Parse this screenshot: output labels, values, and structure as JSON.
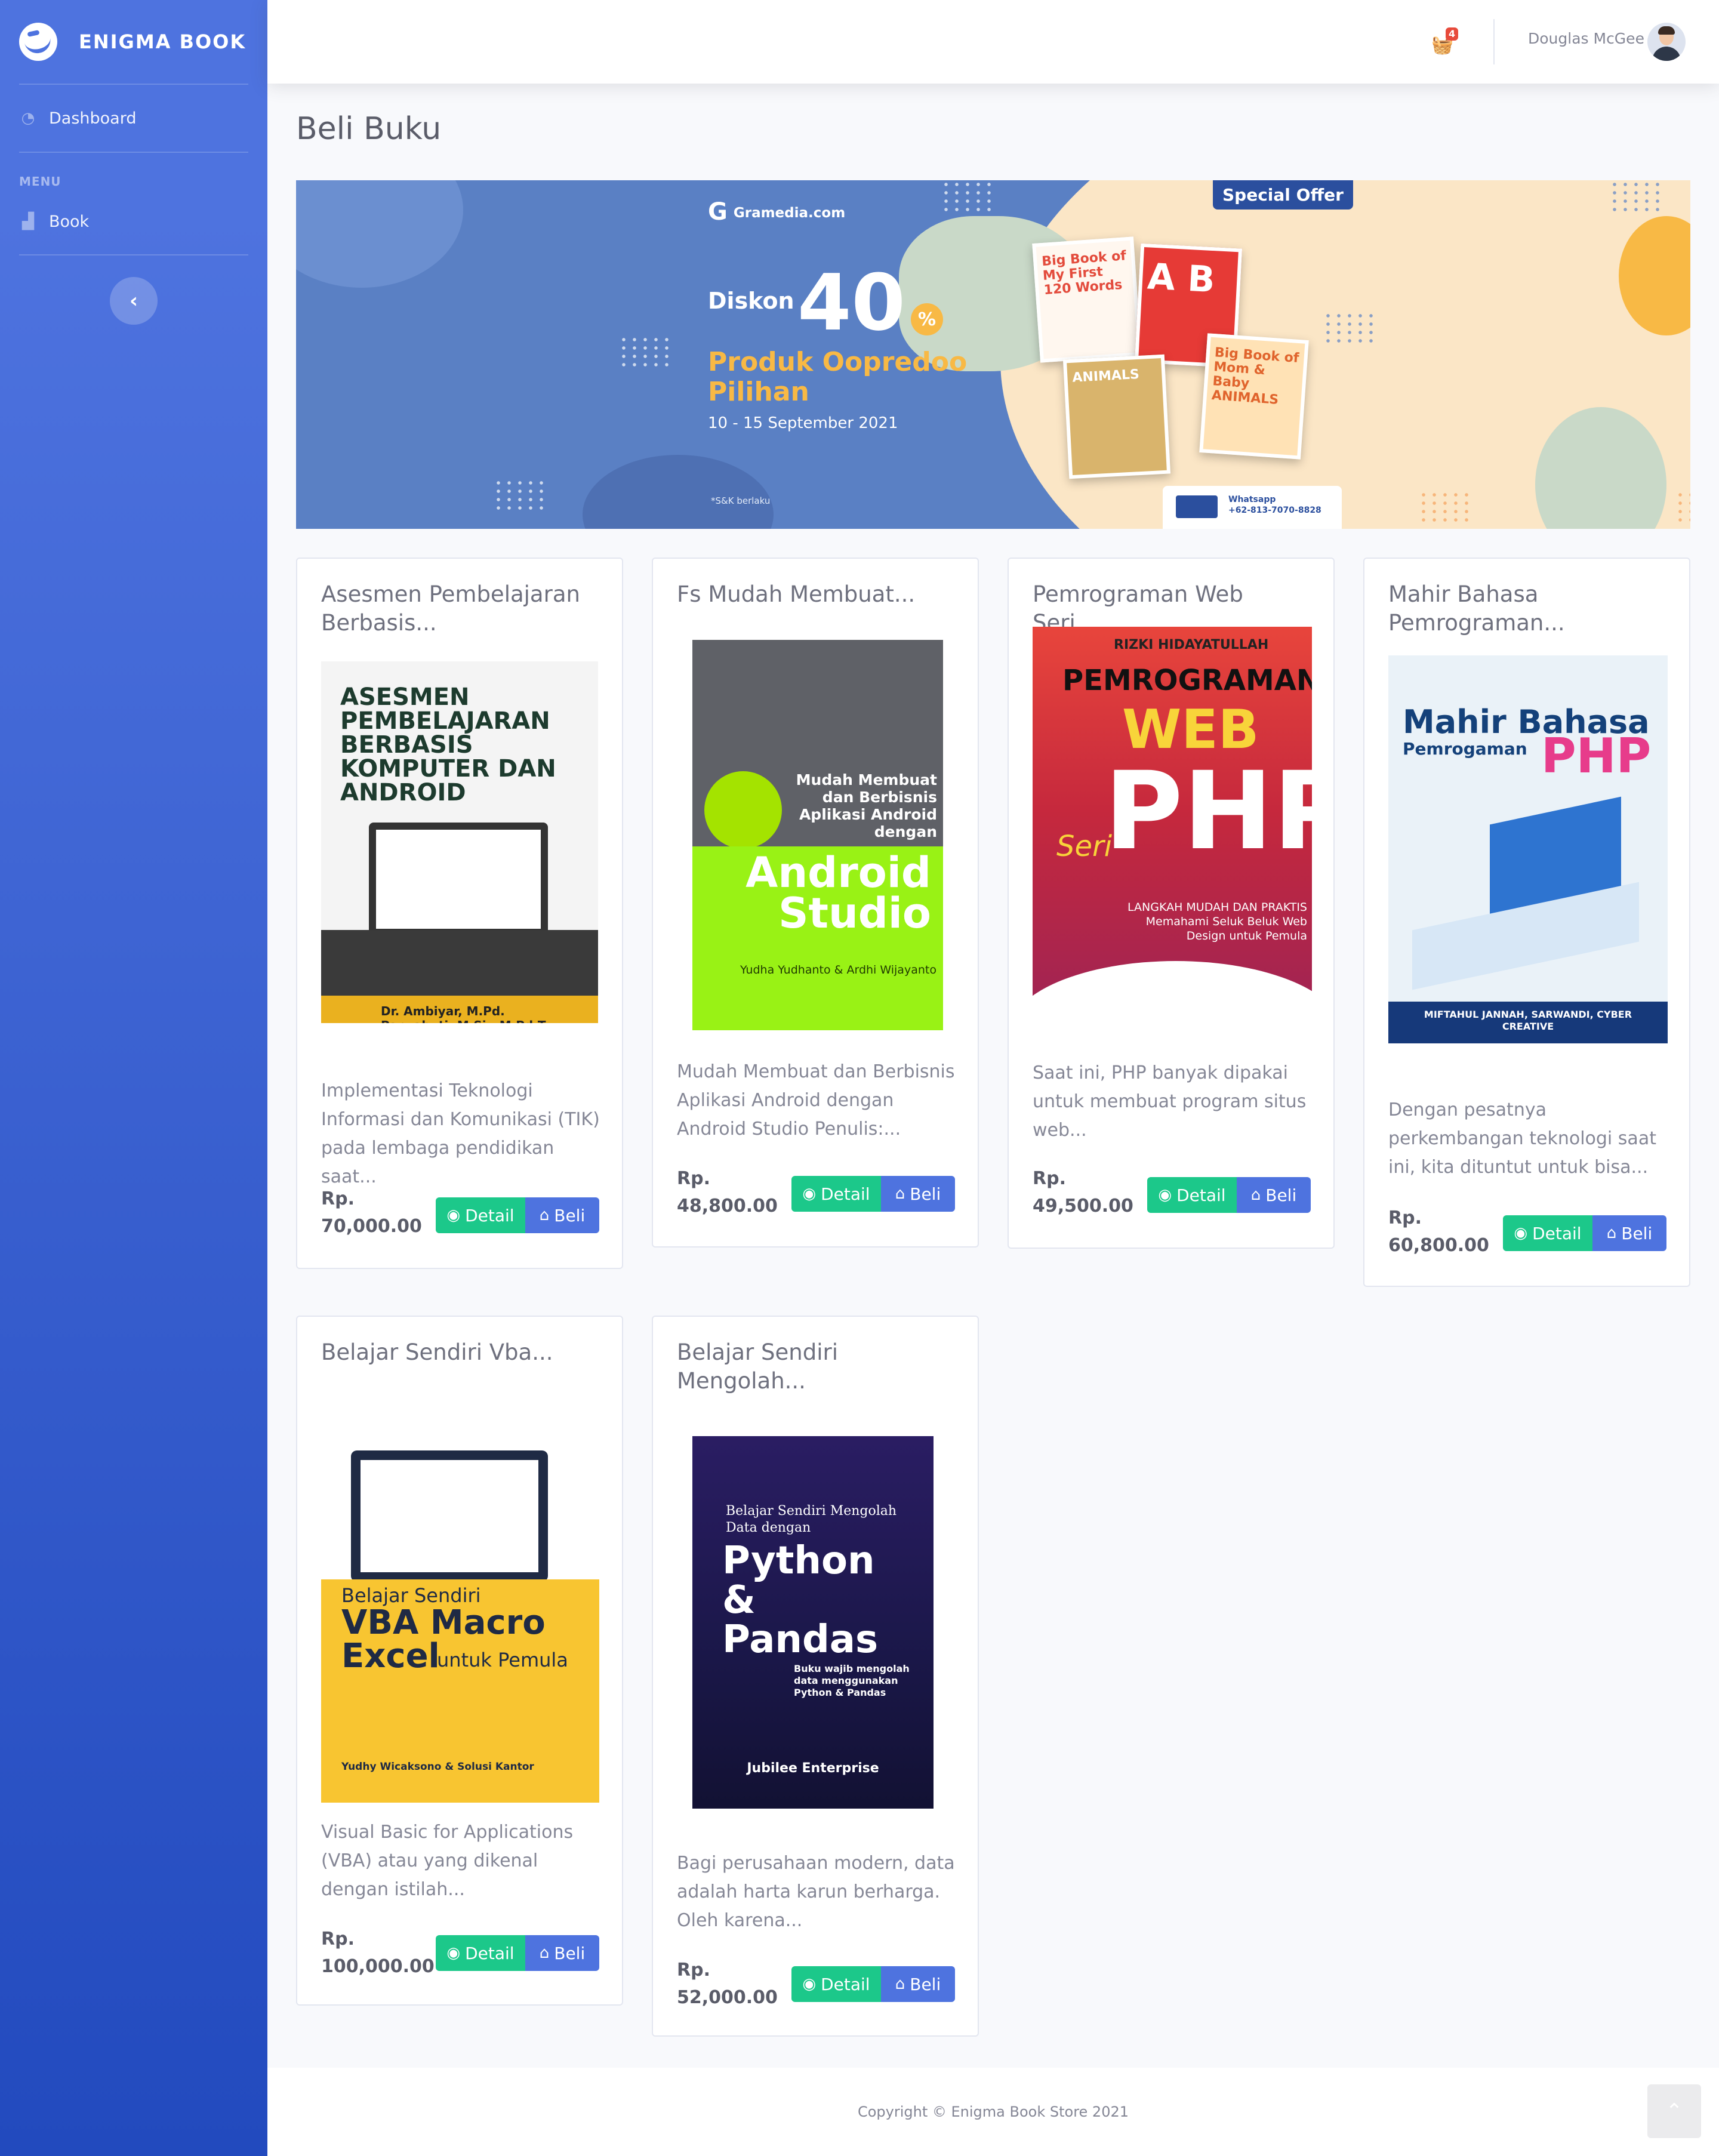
{
  "brand": {
    "name": "ENIGMA BOOK"
  },
  "sidebar": {
    "items": [
      {
        "label": "Dashboard",
        "icon": "tachometer-icon"
      },
      {
        "label": "Book",
        "icon": "chart-area-icon"
      }
    ],
    "heading": "MENU",
    "toggle_icon": "chevron-left-icon"
  },
  "topbar": {
    "cart_count": "4",
    "user_name": "Douglas McGee"
  },
  "page": {
    "title": "Beli Buku"
  },
  "banner": {
    "store": "Gramedia.com",
    "offer": "Special Offer",
    "discount_word": "Diskon",
    "discount_number": "40",
    "discount_symbol": "%",
    "product": "Produk Oopredoo Pilihan",
    "dates": "10 - 15 September 2021",
    "terms": "*S&K berlaku",
    "whatsapp_label": "Whatsapp",
    "whatsapp_number": "+62-813-7070-8828",
    "book1": "Big Book of My First 120 Words",
    "book2": "A B",
    "book3": "ANIMALS",
    "book4": "Big Book of Mom & Baby ANIMALS"
  },
  "buttons": {
    "detail": "Detail",
    "beli": "Beli"
  },
  "books": [
    {
      "title": "Asesmen Pembelajaran Berbasis...",
      "cover_title": "ASESMEN PEMBELAJARAN BERBASIS KOMPUTER DAN ANDROID",
      "cover_authors": "Dr. Ambiyar, M.Pd. Panyahuti, M.Si., M.Pd.T.",
      "description": "Implementasi Teknologi Informasi dan Komunikasi (TIK) pada lembaga pendidikan saat...",
      "price_label": "Rp.",
      "price": "70,000.00"
    },
    {
      "title": "Fs Mudah Membuat...",
      "cover_title": "Mudah Membuat dan Berbisnis Aplikasi Android dengan",
      "cover_brand": "Android Studio",
      "cover_authors": "Yudha Yudhanto & Ardhi Wijayanto",
      "description": "Mudah Membuat dan Berbisnis Aplikasi Android dengan Android Studio Penulis:...",
      "price_label": "Rp.",
      "price": "48,800.00"
    },
    {
      "title": "Pemrograman Web Seri...",
      "cover_author": "RIZKI HIDAYATULLAH",
      "cover_title": "PEMROGRAMAN",
      "cover_web": "WEB",
      "cover_php": "PHP",
      "cover_seri": "Seri",
      "cover_sub": "LANGKAH MUDAH DAN PRAKTIS Memahami Seluk Beluk Web Design untuk Pemula",
      "description": "Saat ini, PHP banyak dipakai untuk membuat program situs web...",
      "price_label": "Rp.",
      "price": "49,500.00"
    },
    {
      "title": "Mahir Bahasa Pemrograman...",
      "cover_title": "Mahir Bahasa",
      "cover_sub": "Pemrogaman",
      "cover_php": "PHP",
      "cover_authors": "MIFTAHUL JANNAH, SARWANDI, CYBER CREATIVE",
      "description": "Dengan pesatnya perkembangan teknologi saat ini, kita dituntut untuk bisa...",
      "price_label": "Rp.",
      "price": "60,800.00"
    },
    {
      "title": "Belajar Sendiri Vba...",
      "cover_pre": "Belajar Sendiri",
      "cover_title": "VBA Macro",
      "cover_excel": "Excel",
      "cover_excel_sub": "untuk Pemula",
      "cover_authors": "Yudhy Wicaksono & Solusi Kantor",
      "description": "Visual Basic for Applications (VBA) atau yang dikenal dengan istilah...",
      "price_label": "Rp.",
      "price": "100,000.00"
    },
    {
      "title": "Belajar Sendiri Mengolah...",
      "cover_pre": "Belajar Sendiri Mengolah Data dengan",
      "cover_title": "Python & Pandas",
      "cover_sub": "Buku wajib mengolah data menggunakan Python & Pandas",
      "cover_publisher": "Jubilee Enterprise",
      "description": "Bagi perusahaan modern, data adalah harta karun berharga. Oleh karena...",
      "price_label": "Rp.",
      "price": "52,000.00"
    }
  ],
  "footer": {
    "copyright": "Copyright © Enigma Book Store 2021"
  },
  "scroll_top_icon": "chevron-up-icon",
  "colors": {
    "primary": "#4e73df",
    "success": "#1cc88a",
    "danger": "#e74a3b"
  }
}
